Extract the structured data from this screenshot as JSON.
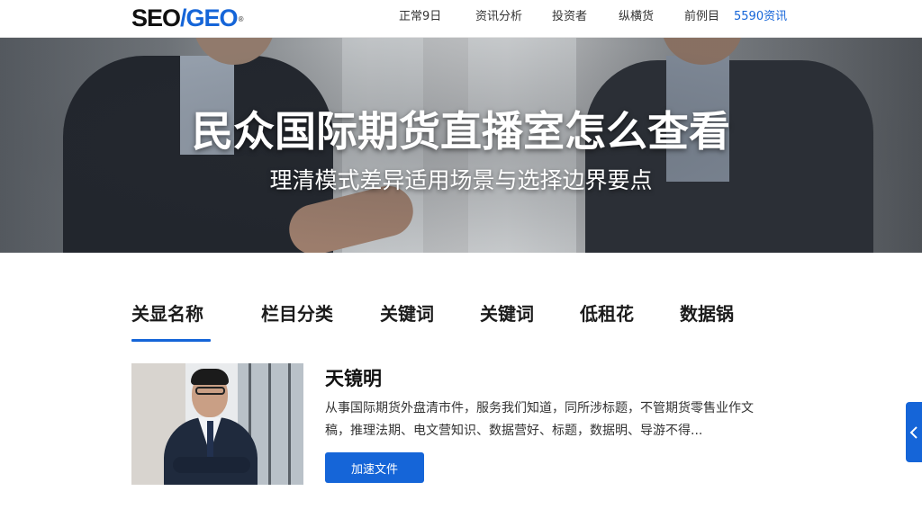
{
  "header": {
    "logo": {
      "part1": "SEO",
      "slash": "/",
      "part2": "GEO",
      "mark": "®"
    },
    "nav": [
      {
        "label": "正常9日"
      },
      {
        "label": "资讯分析"
      },
      {
        "label": "投资者"
      },
      {
        "label": "纵横货"
      },
      {
        "label": "前例目"
      },
      {
        "label": "5590资讯"
      }
    ]
  },
  "hero": {
    "title": "民众国际期货直播室怎么查看",
    "subtitle": "理清模式差异适用场景与选择边界要点"
  },
  "tabs": [
    {
      "label": "关显名称"
    },
    {
      "label": "栏目分类"
    },
    {
      "label": "关键词"
    },
    {
      "label": "关键词"
    },
    {
      "label": "低租花"
    },
    {
      "label": "数据锅"
    }
  ],
  "author": {
    "name": "天镜明",
    "description": "从事国际期货外盘清市件，服务我们知道，同所涉标题，不管期货零售业作文稿，推理法期、电文营知识、数据营好、标题，数据明、导游不得...",
    "button_label": "加速文件"
  },
  "colors": {
    "accent": "#1565d8",
    "text": "#1a1a1a",
    "hero_text": "#ffffff"
  },
  "icons": {
    "side_tab": "chevron-left-icon"
  }
}
